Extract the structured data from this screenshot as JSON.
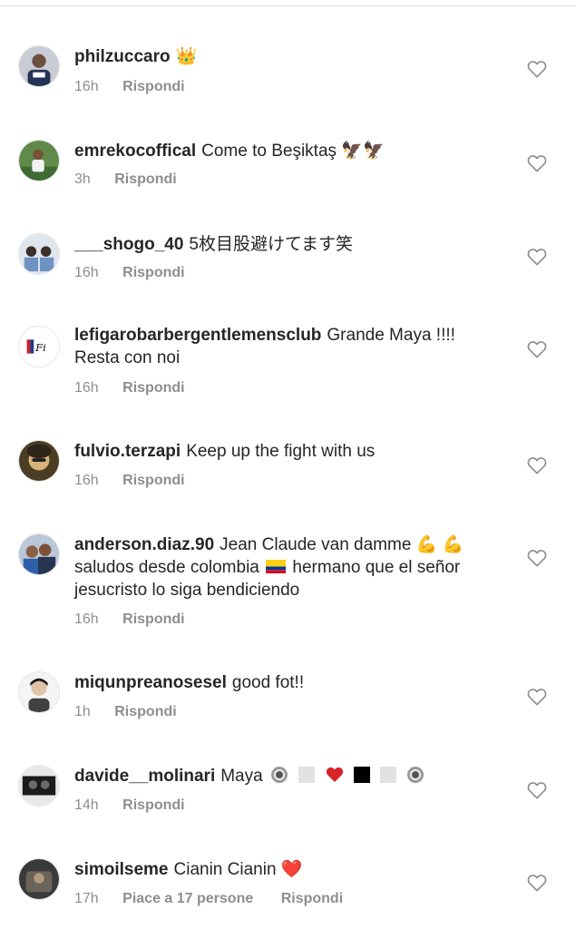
{
  "reply_label": "Rispondi",
  "comments": [
    {
      "username": "philzuccaro",
      "text": "👑",
      "time": "16h"
    },
    {
      "username": "emrekocoffical",
      "text": "Come to Beşiktaş 🦅🦅",
      "time": "3h"
    },
    {
      "username": "___shogo_40",
      "text": "5枚目股避けてます笑",
      "time": "16h"
    },
    {
      "username": "lefigarobarbergentlemensclub",
      "text": "Grande Maya !!!! Resta con noi",
      "time": "16h"
    },
    {
      "username": "fulvio.terzapi",
      "text": "Keep up the fight with us",
      "time": "16h"
    },
    {
      "username": "anderson.diaz.90",
      "text_a": "Jean Claude van damme 💪 💪 saludos desde colombia",
      "text_b": "hermano que el señor jesucristo lo siga bendiciendo",
      "time": "16h"
    },
    {
      "username": "miqunpreanosesel",
      "text": "good fot!!",
      "time": "1h"
    },
    {
      "username": "davide__molinari",
      "text": "Maya",
      "time": "14h"
    },
    {
      "username": "simoilseme",
      "text": "Cianin Cianin ❤️",
      "time": "17h",
      "likes": "Piace a 17 persone"
    }
  ],
  "icons": {
    "like": "heart-outline-icon",
    "flag": "colombia-flag"
  },
  "colors": {
    "text": "#262626",
    "meta": "#8e8e8e",
    "heart_stroke": "#8e8e8e",
    "heart_red": "#ed1c24"
  }
}
